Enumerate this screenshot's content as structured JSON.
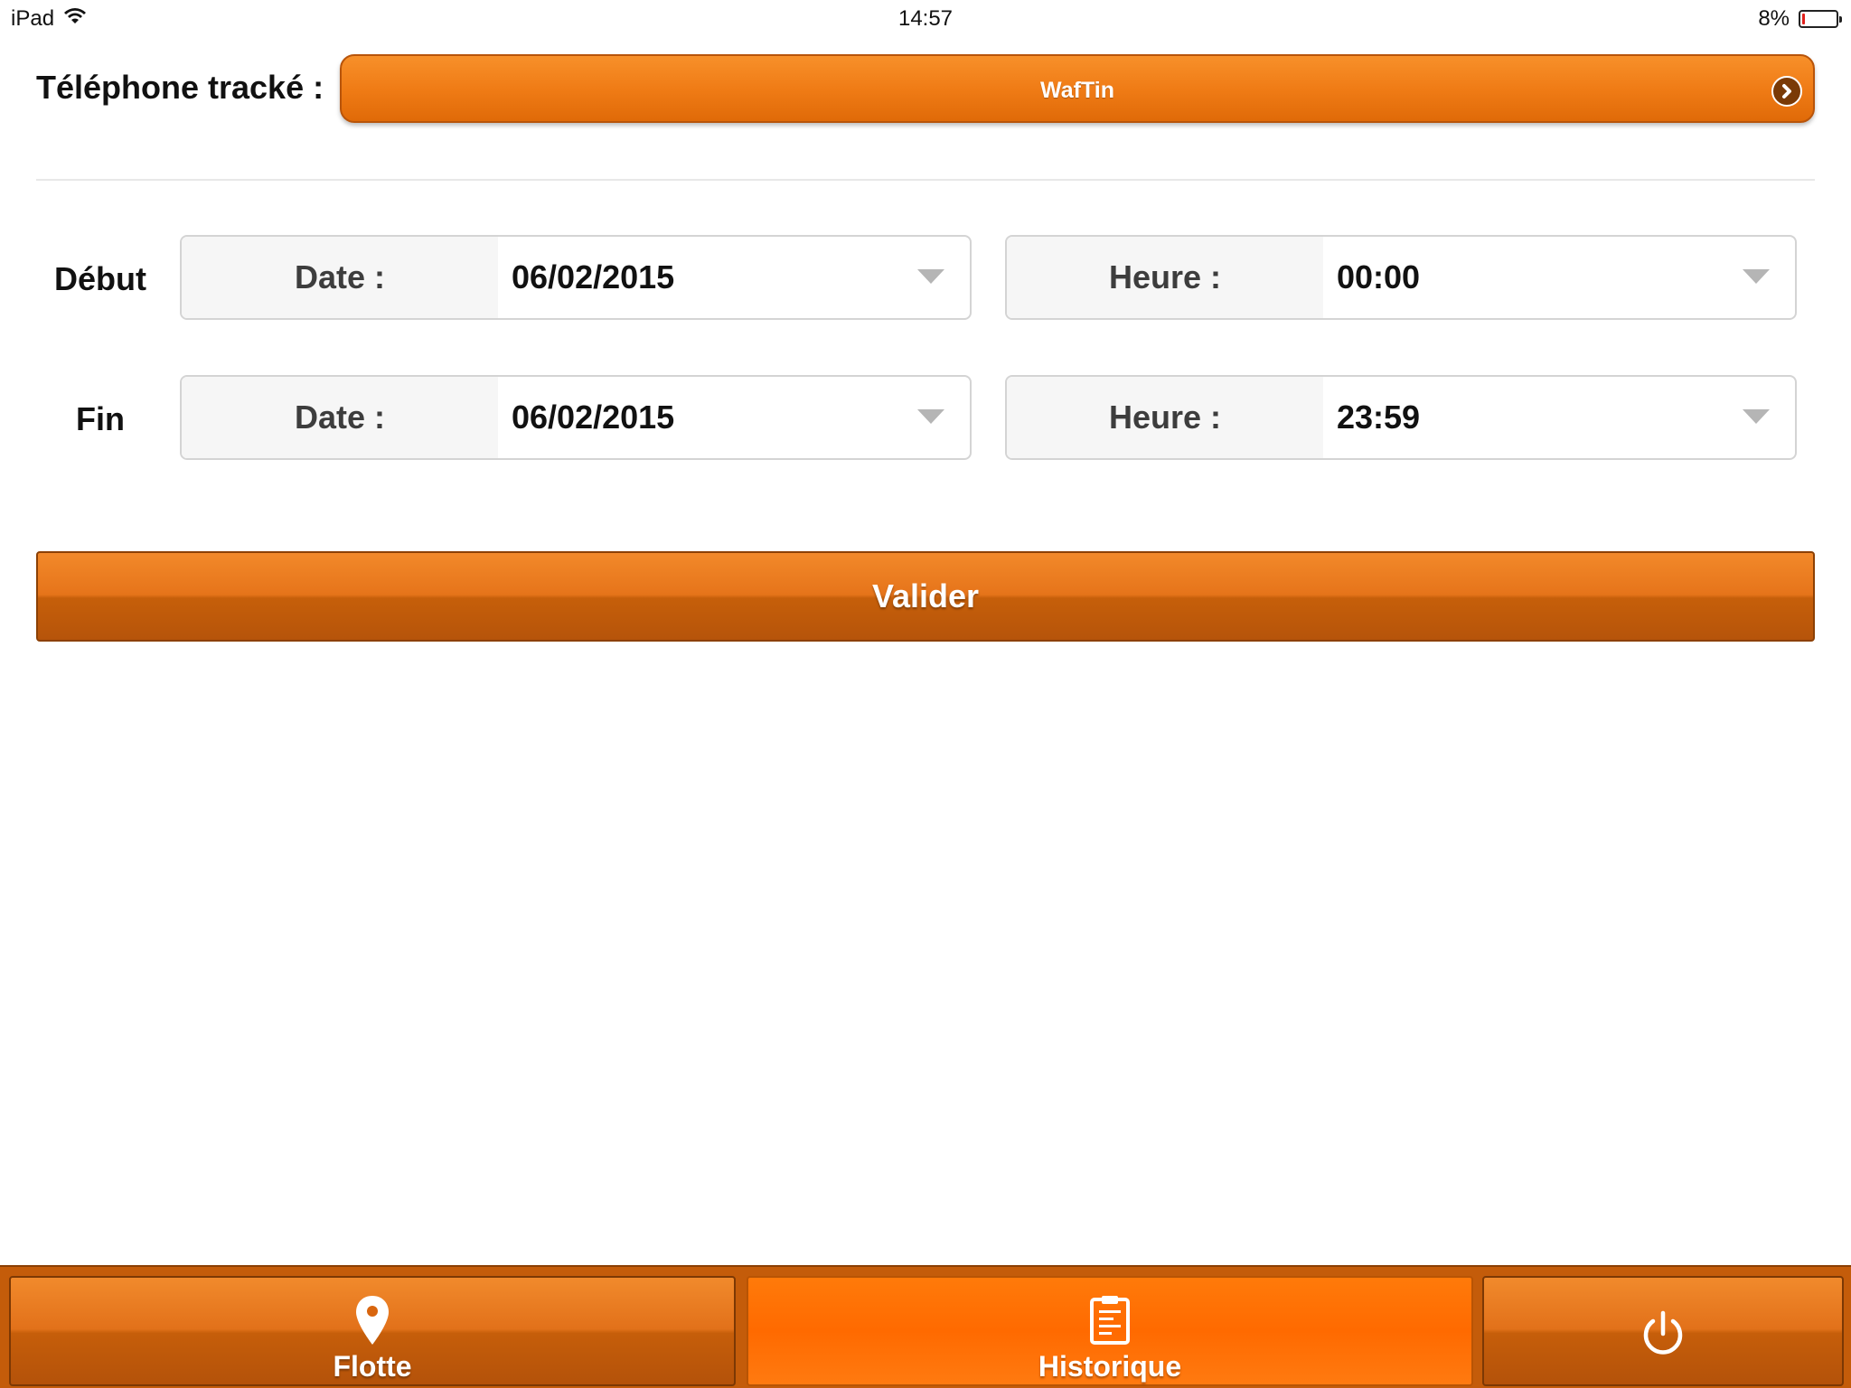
{
  "status_bar": {
    "device": "iPad",
    "time": "14:57",
    "battery_percent_label": "8%",
    "battery_level": 0.08
  },
  "tracked_phone": {
    "label": "Téléphone tracké :",
    "value": "WafTin"
  },
  "period": {
    "start": {
      "label": "Début",
      "date_label": "Date :",
      "date_value": "06/02/2015",
      "time_label": "Heure :",
      "time_value": "00:00"
    },
    "end": {
      "label": "Fin",
      "date_label": "Date :",
      "date_value": "06/02/2015",
      "time_label": "Heure :",
      "time_value": "23:59"
    }
  },
  "actions": {
    "validate_label": "Valider"
  },
  "tab_bar": {
    "tabs": [
      {
        "label": "Flotte",
        "icon": "map-pin-icon",
        "active": false
      },
      {
        "label": "Historique",
        "icon": "clipboard-icon",
        "active": true
      },
      {
        "label": "",
        "icon": "power-icon",
        "active": false
      }
    ]
  },
  "colors": {
    "accent": "#f07c16",
    "accent_dark": "#b6540a",
    "active_tab": "#ff6a00",
    "battery_low": "#e0201b"
  }
}
